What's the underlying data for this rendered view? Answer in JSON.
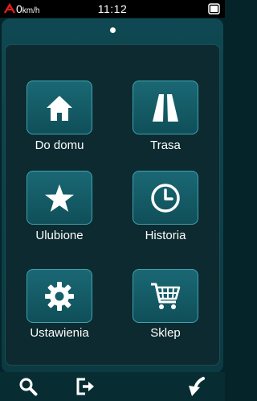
{
  "status_bar": {
    "speed_value": "0",
    "speed_unit": "km/h",
    "time": "11:12"
  },
  "menu": {
    "items": [
      {
        "label": "Do domu",
        "icon": "home-icon"
      },
      {
        "label": "Trasa",
        "icon": "road-icon"
      },
      {
        "label": "Ulubione",
        "icon": "star-icon"
      },
      {
        "label": "Historia",
        "icon": "clock-icon"
      },
      {
        "label": "Ustawienia",
        "icon": "gear-icon"
      },
      {
        "label": "Sklep",
        "icon": "shopping-cart-icon"
      }
    ]
  },
  "toolbar": {
    "icons": [
      "search-icon",
      "exit-icon",
      "back-icon"
    ]
  },
  "colors": {
    "background": "#05242a",
    "tile": "#1a6874",
    "tile_border": "#3fa3b0",
    "logo_red": "#e01e1e"
  }
}
